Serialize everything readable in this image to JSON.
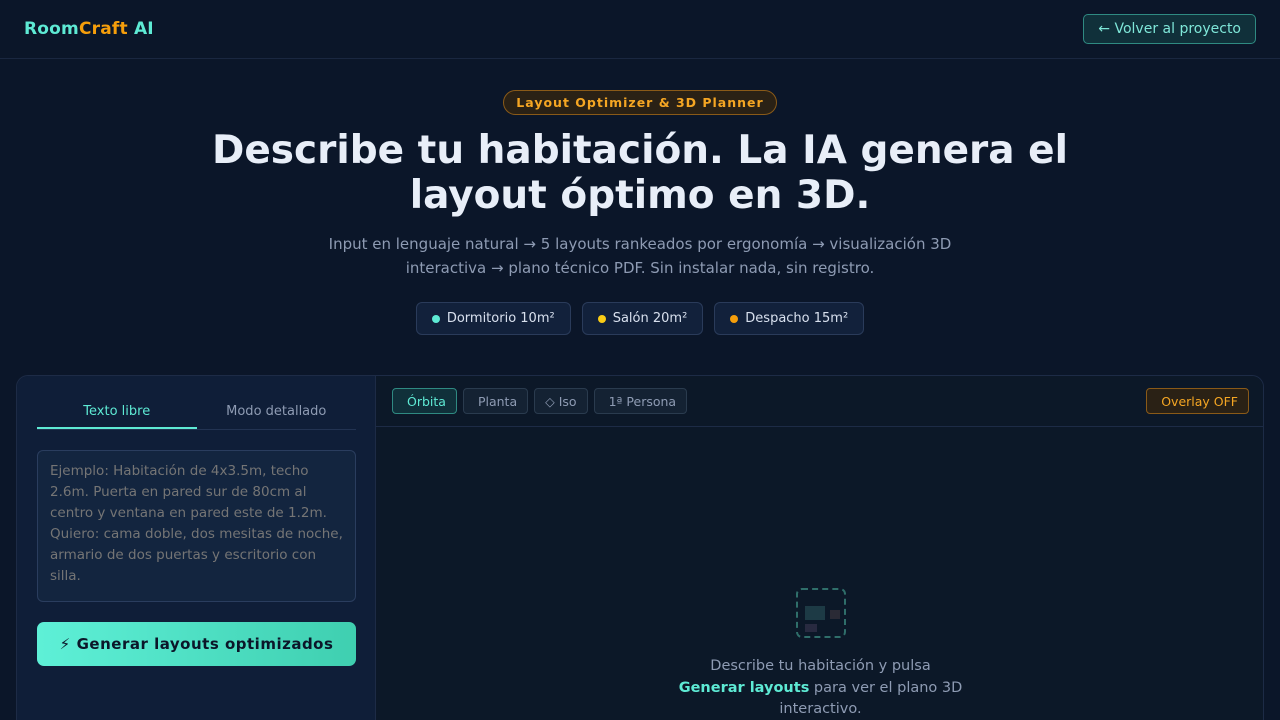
{
  "header": {
    "brand_part1": "Room",
    "brand_part2": "Craft",
    "brand_part3": " AI",
    "back_label": "← Volver al proyecto"
  },
  "hero": {
    "badge": "Layout Optimizer & 3D Planner",
    "headline": "Describe tu habitación. La IA genera el layout óptimo en 3D.",
    "subtitle": "Input en lenguaje natural → 5 layouts rankeados por ergonomía → visualización 3D interactiva → plano técnico PDF. Sin instalar nada, sin registro.",
    "chips": [
      {
        "label": "Dormitorio 10m²",
        "color": "#5eead4"
      },
      {
        "label": "Salón 20m²",
        "color": "#facc15"
      },
      {
        "label": "Despacho 15m²",
        "color": "#f59e0b"
      }
    ]
  },
  "input_panel": {
    "tabs": [
      "Texto libre",
      "Modo detallado"
    ],
    "active_tab": "Texto libre",
    "textarea_value": "",
    "textarea_placeholder": "Ejemplo: Habitación de 4x3.5m, techo 2.6m. Puerta en pared sur de 80cm al centro y ventana en pared este de 1.2m. Quiero: cama doble, dos mesitas de noche, armario de dos puertas y escritorio con silla.",
    "generate_icon": "⚡",
    "generate_label": "Generar layouts optimizados"
  },
  "viewer": {
    "views": [
      {
        "icon": "",
        "label": "Órbita",
        "active": true
      },
      {
        "icon": "",
        "label": "Planta",
        "active": false
      },
      {
        "icon": "◇",
        "label": "Iso",
        "active": false
      },
      {
        "icon": "",
        "label": "1ª Persona",
        "active": false
      }
    ],
    "overlay_icon": "",
    "overlay_label": "Overlay OFF",
    "empty_text_1": "Describe tu habitación y pulsa ",
    "empty_text_highlight": "Generar layouts",
    "empty_text_2": " para ver el plano 3D interactivo."
  },
  "colors": {
    "accent": "#5eead4",
    "warning": "#f59e0b",
    "background": "#0b1629"
  }
}
